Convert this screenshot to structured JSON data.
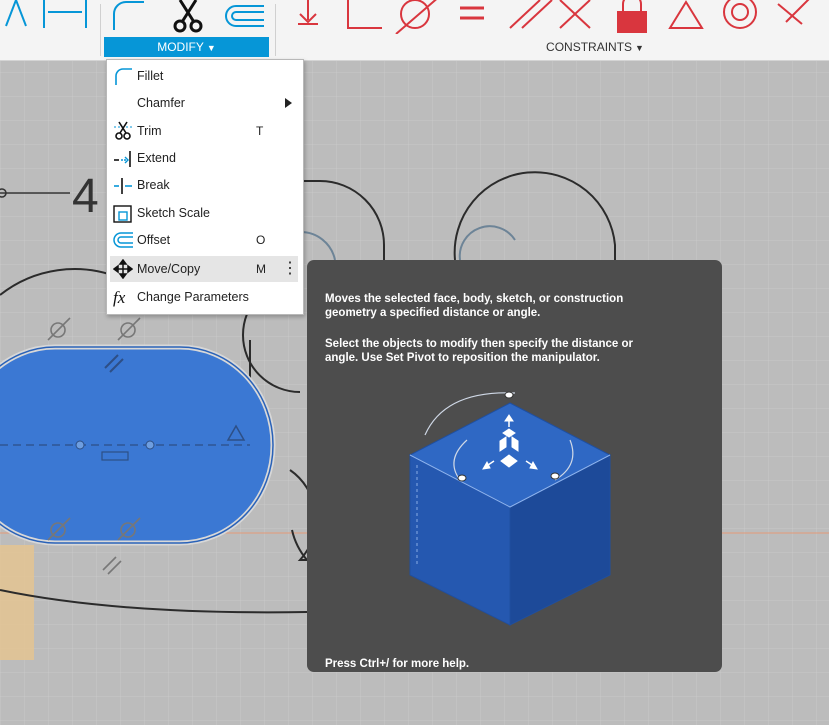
{
  "toolbar": {
    "modify_label": "MODIFY",
    "constraints_label": "CONSTRAINTS",
    "caret": "▼",
    "accent": "#0696d7",
    "constraint_color": "#d9363e"
  },
  "menu": {
    "items": [
      {
        "label": "Fillet",
        "shortcut": "",
        "icon": "fillet-icon"
      },
      {
        "label": "Chamfer",
        "shortcut": "",
        "icon": "none",
        "submenu": true
      },
      {
        "label": "Trim",
        "shortcut": "T",
        "icon": "trim-icon"
      },
      {
        "label": "Extend",
        "shortcut": "",
        "icon": "extend-icon"
      },
      {
        "label": "Break",
        "shortcut": "",
        "icon": "break-icon"
      },
      {
        "label": "Sketch Scale",
        "shortcut": "",
        "icon": "sketch-scale-icon"
      },
      {
        "label": "Offset",
        "shortcut": "O",
        "icon": "offset-icon"
      },
      {
        "label": "Move/Copy",
        "shortcut": "M",
        "icon": "move-icon",
        "highlighted": true
      },
      {
        "label": "Change Parameters",
        "shortcut": "",
        "icon": "fx-icon"
      }
    ]
  },
  "canvas": {
    "dimension_text": "4"
  },
  "tooltip": {
    "line1": "Moves the selected face, body, sketch, or construction",
    "line2": "geometry a specified distance or angle.",
    "line3": "Select the objects to modify then specify the distance or",
    "line4": "angle. Use Set Pivot to reposition the manipulator.",
    "help": "Press Ctrl+/ for more help."
  }
}
